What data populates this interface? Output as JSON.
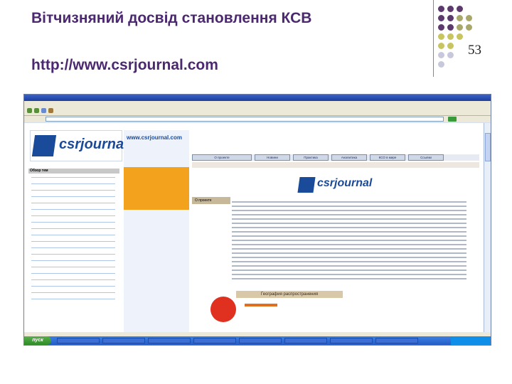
{
  "slide": {
    "title": "Вітчизняний досвід становлення КСВ",
    "url": "http://www.csrjournal.com",
    "page_number": "53"
  },
  "decor": {
    "dot_colors": [
      "#5c3a6e",
      "#a8a86a",
      "#c8c460",
      "#c8c8dc"
    ]
  },
  "browser": {
    "site_logo_text": "csrjournal",
    "mid_url": "www.csrjournal.com",
    "nav_buttons": [
      "О проекте",
      "Новини",
      "Практика",
      "Аналитика",
      "КСО в мире",
      "Ссылки"
    ],
    "left_header": "Обзор тем",
    "content_tab": "О проекте",
    "geo_box": "География распространения",
    "start_label": "пуск"
  }
}
